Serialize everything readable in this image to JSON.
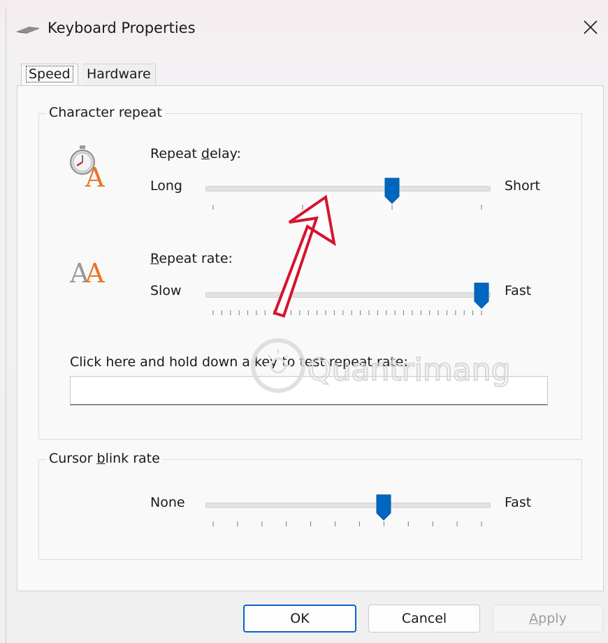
{
  "window": {
    "title": "Keyboard Properties",
    "icon": "keyboard-icon",
    "close_icon": "close-icon"
  },
  "tabs": [
    {
      "label": "Speed",
      "selected": true
    },
    {
      "label": "Hardware",
      "selected": false
    }
  ],
  "character_repeat": {
    "group_title": "Character repeat",
    "repeat_delay": {
      "label_pre": "Repeat ",
      "label_accel": "d",
      "label_post": "elay:",
      "min_label": "Long",
      "max_label": "Short",
      "icon": "stopwatch-letter-icon",
      "position": 2,
      "steps": 3
    },
    "repeat_rate": {
      "label_accel": "R",
      "label_post": "epeat rate:",
      "min_label": "Slow",
      "max_label": "Fast",
      "icon": "double-letter-a-icon",
      "position": 31,
      "steps": 31
    },
    "test_label": "Click here and hold down a key to test repeat rate:",
    "test_value": ""
  },
  "cursor_blink": {
    "group_title_pre": "Cursor ",
    "group_title_accel": "b",
    "group_title_post": "link rate",
    "min_label": "None",
    "max_label": "Fast",
    "position": 7,
    "steps": 11
  },
  "buttons": {
    "ok": "OK",
    "cancel": "Cancel",
    "apply_accel": "A",
    "apply_post": "pply",
    "apply_enabled": false
  },
  "watermark": {
    "text": "Quantrimang"
  },
  "colors": {
    "accent": "#0b63c8",
    "thumb": "#0067c0",
    "annotation_arrow": "#d6142e",
    "letter_orange": "#e8762a"
  }
}
